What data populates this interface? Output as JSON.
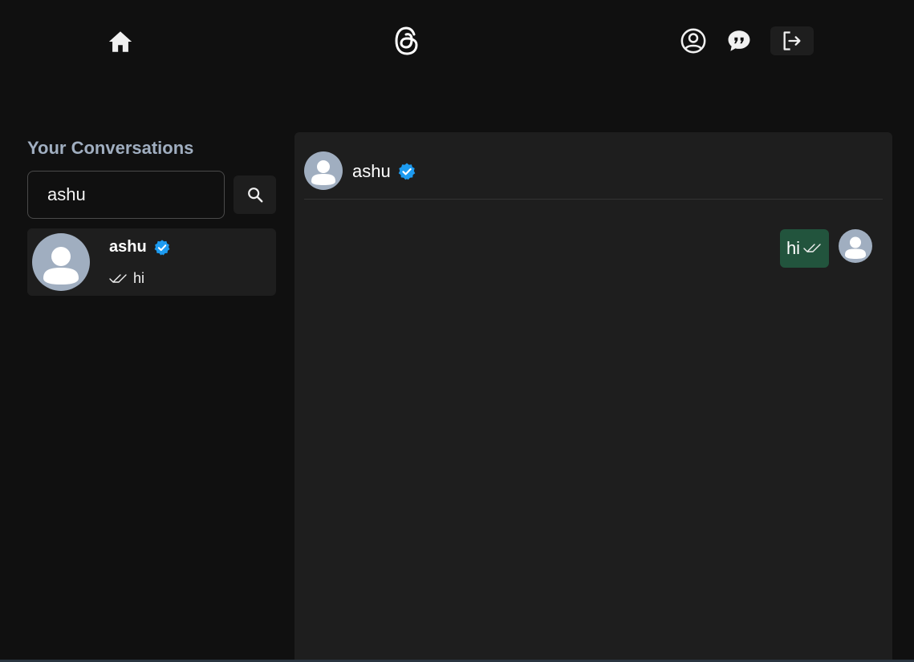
{
  "nav": {
    "home_icon": "home-icon",
    "logo_icon": "threads-logo-icon",
    "profile_icon": "user-circle-icon",
    "chat_icon": "chat-quote-icon",
    "logout_icon": "logout-icon"
  },
  "sidebar": {
    "title": "Your Conversations",
    "search": {
      "value": "ashu",
      "placeholder": ""
    },
    "search_icon": "search-icon",
    "conversations": [
      {
        "name": "ashu",
        "verified": true,
        "last_message": "hi",
        "read_icon": "double-check-icon"
      }
    ]
  },
  "chat": {
    "header": {
      "name": "ashu",
      "verified": true
    },
    "messages": [
      {
        "text": "hi",
        "from_me": true,
        "status_icon": "double-check-icon"
      }
    ]
  },
  "colors": {
    "background": "#101010",
    "panel": "#1e1e1e",
    "title": "#a0aec0",
    "verified": "#1d9bf0",
    "bubble": "#22543d",
    "avatar": "#a0aec0"
  }
}
